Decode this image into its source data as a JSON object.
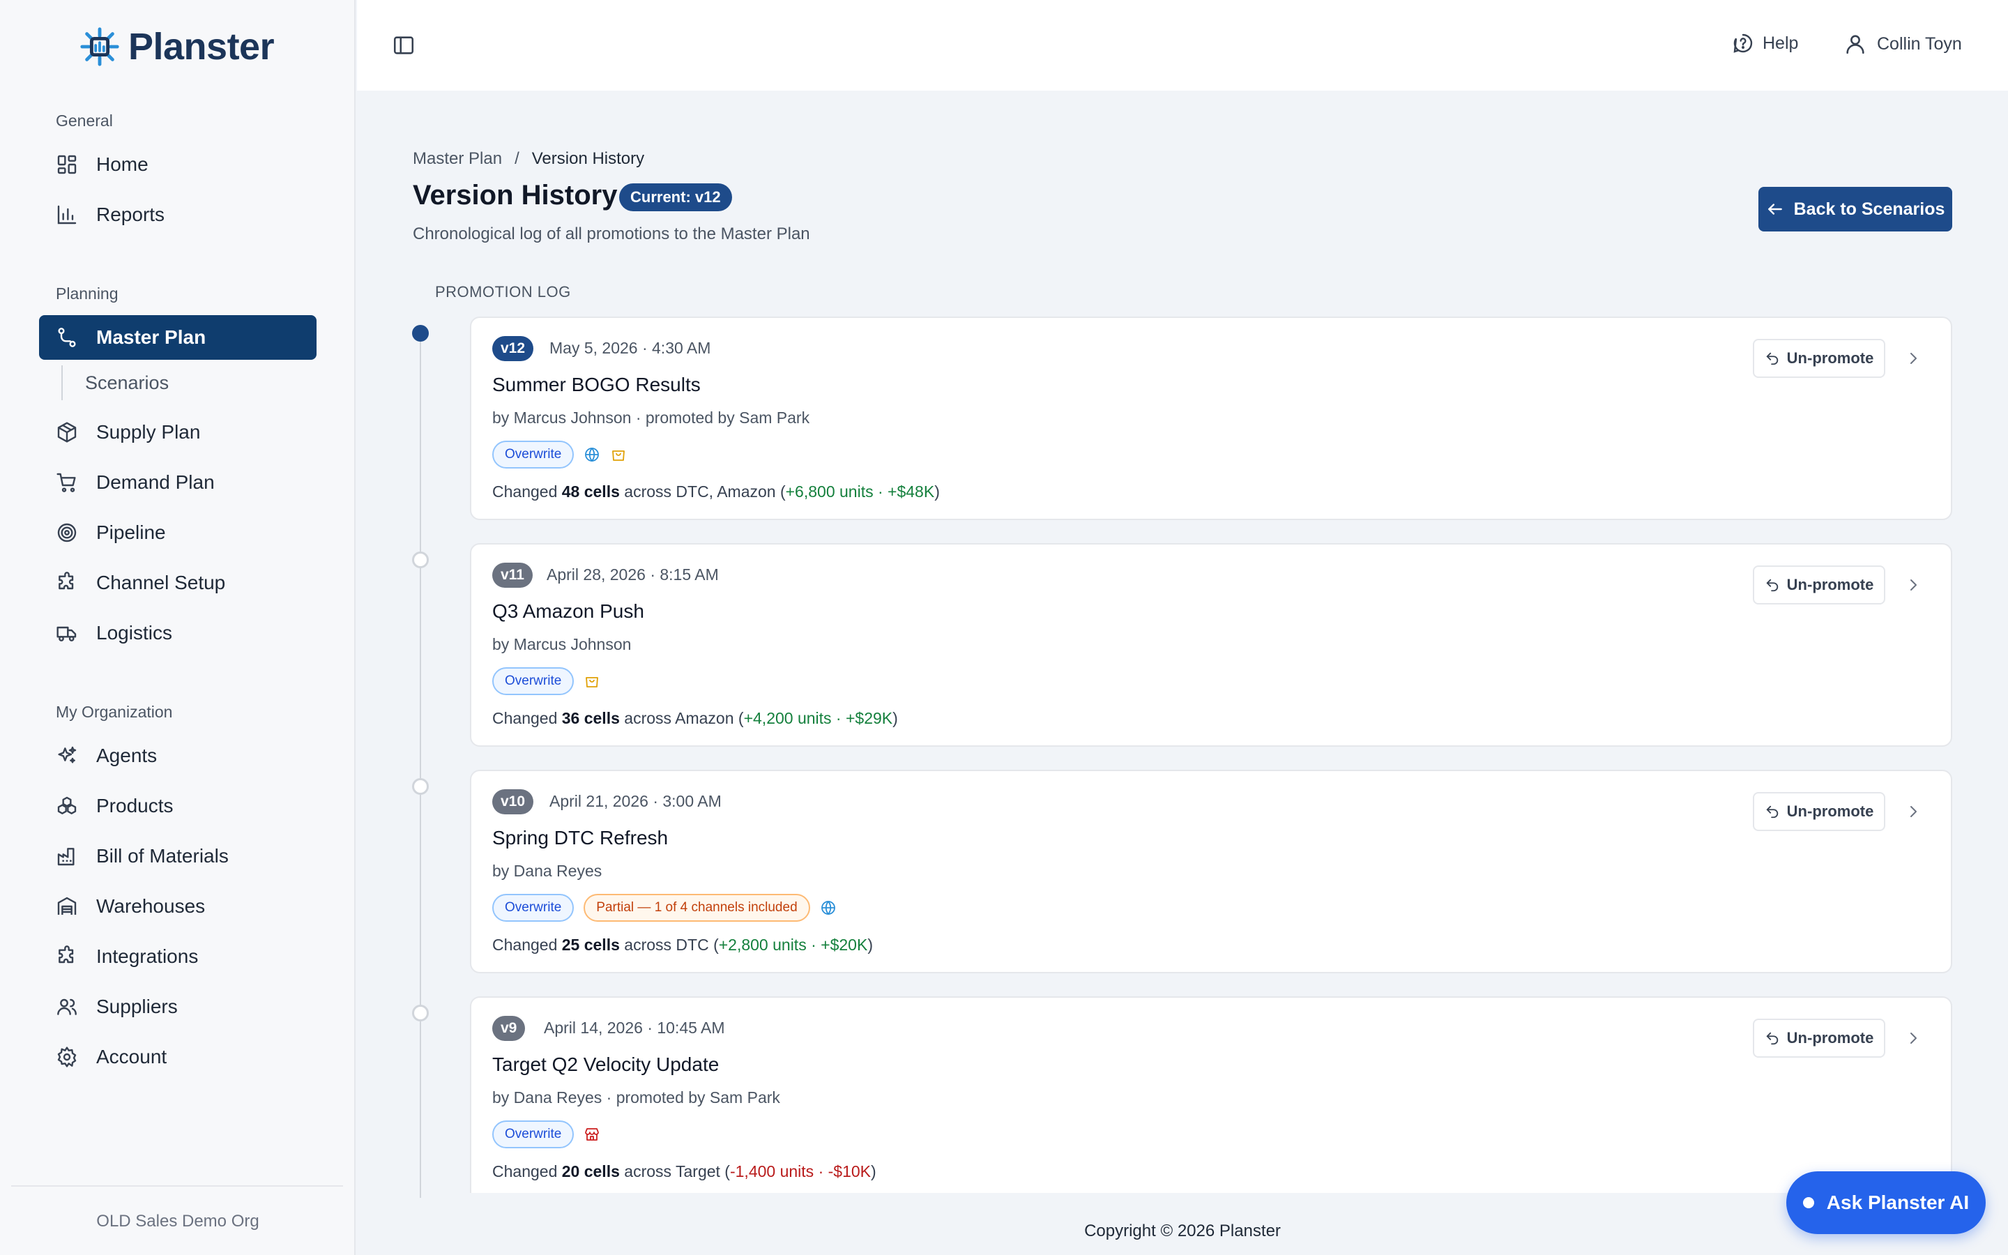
{
  "brand": {
    "name": "Planster"
  },
  "sidebar": {
    "sections": [
      {
        "label": "General"
      },
      {
        "label": "Planning"
      },
      {
        "label": "My Organization"
      }
    ],
    "items": [
      {
        "label": "Home",
        "icon": "dashboard-icon"
      },
      {
        "label": "Reports",
        "icon": "bar-chart-icon"
      },
      {
        "label": "Master Plan",
        "icon": "route-icon",
        "active": true
      },
      {
        "label": "Scenarios",
        "sub": true
      },
      {
        "label": "Supply Plan",
        "icon": "package-icon"
      },
      {
        "label": "Demand Plan",
        "icon": "cart-icon"
      },
      {
        "label": "Pipeline",
        "icon": "target-icon"
      },
      {
        "label": "Channel Setup",
        "icon": "puzzle-icon"
      },
      {
        "label": "Logistics",
        "icon": "truck-icon"
      },
      {
        "label": "Agents",
        "icon": "sparkles-icon"
      },
      {
        "label": "Products",
        "icon": "boxes-icon"
      },
      {
        "label": "Bill of Materials",
        "icon": "factory-icon"
      },
      {
        "label": "Warehouses",
        "icon": "warehouse-icon"
      },
      {
        "label": "Integrations",
        "icon": "puzzle-icon"
      },
      {
        "label": "Suppliers",
        "icon": "users-icon"
      },
      {
        "label": "Account",
        "icon": "gear-icon"
      }
    ],
    "org": "OLD Sales Demo Org"
  },
  "topbar": {
    "help": "Help",
    "user": "Collin Toyn"
  },
  "breadcrumb": {
    "parent": "Master Plan",
    "sep": "/",
    "current": "Version History"
  },
  "page": {
    "title": "Version History",
    "current_badge": "Current: v12",
    "subtitle": "Chronological log of all promotions to the Master Plan",
    "back_button": "Back to Scenarios",
    "log_label": "PROMOTION LOG"
  },
  "versions": [
    {
      "version": "v12",
      "date": "May 5, 2026 · 4:30 AM",
      "title": "Summer BOGO Results",
      "author": "by Marcus Johnson · promoted by Sam Park",
      "mode": "Overwrite",
      "channels": [
        "globe-icon",
        "shopping-bag-icon"
      ],
      "change_prefix": "Changed ",
      "cells": "48 cells",
      "across": " across DTC, Amazon (",
      "units": "+6,800 units",
      "dot_sep": " · ",
      "money": "+$48K",
      "close": ")",
      "trend": "positive"
    },
    {
      "version": "v11",
      "date": "April 28, 2026 · 8:15 AM",
      "title": "Q3 Amazon Push",
      "author": "by Marcus Johnson",
      "mode": "Overwrite",
      "channels": [
        "shopping-bag-icon"
      ],
      "change_prefix": "Changed ",
      "cells": "36 cells",
      "across": " across Amazon (",
      "units": "+4,200 units",
      "dot_sep": " · ",
      "money": "+$29K",
      "close": ")",
      "trend": "positive"
    },
    {
      "version": "v10",
      "date": "April 21, 2026 · 3:00 AM",
      "title": "Spring DTC Refresh",
      "author": "by Dana Reyes",
      "mode": "Overwrite",
      "partial": "Partial — 1 of 4 channels included",
      "channels": [
        "globe-icon"
      ],
      "change_prefix": "Changed ",
      "cells": "25 cells",
      "across": " across DTC (",
      "units": "+2,800 units",
      "dot_sep": " · ",
      "money": "+$20K",
      "close": ")",
      "trend": "positive"
    },
    {
      "version": "v9",
      "date": "April 14, 2026 · 10:45 AM",
      "title": "Target Q2 Velocity Update",
      "author": "by Dana Reyes · promoted by Sam Park",
      "mode": "Overwrite",
      "channels": [
        "store-icon"
      ],
      "change_prefix": "Changed ",
      "cells": "20 cells",
      "across": " across Target (",
      "units": "-1,400 units",
      "dot_sep": " · ",
      "money": "-$10K",
      "close": ")",
      "trend": "negative"
    }
  ],
  "actions": {
    "unpromote": "Un-promote"
  },
  "footer": "Copyright © 2026 Planster",
  "assistant": {
    "label": "Ask Planster AI"
  },
  "colors": {
    "primary": "#1e4b8a",
    "sidebar_active": "#0f3d6e",
    "positive": "#15803d",
    "negative": "#b91c1c",
    "assistant": "#2563eb"
  }
}
